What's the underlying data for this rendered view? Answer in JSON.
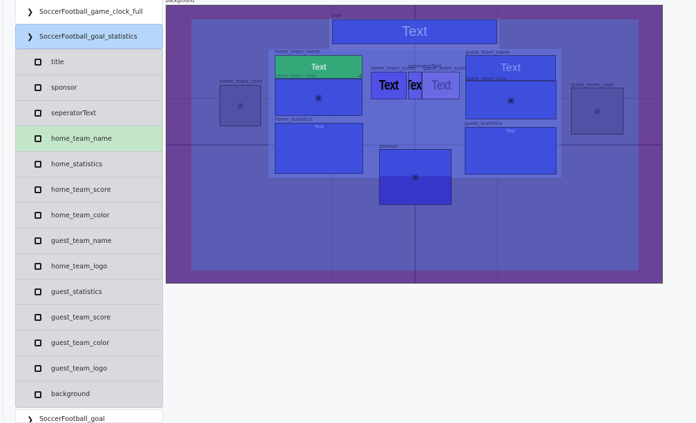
{
  "sidebar": {
    "groups": [
      {
        "label": "SoccerFootball_game_clock_full",
        "icon": "chevron-right-icon",
        "selected": false
      },
      {
        "label": "SoccerFootball_goal_statistics",
        "icon": "chevron-right-icon",
        "selected": true
      },
      {
        "label": "SoccerFootball_goal",
        "icon": "chevron-right-icon",
        "selected": false
      }
    ],
    "children": [
      {
        "label": "title",
        "icon": "square-outline-icon"
      },
      {
        "label": "sponsor",
        "icon": "square-outline-icon"
      },
      {
        "label": "seperatorText",
        "icon": "square-outline-icon"
      },
      {
        "label": "home_team_name",
        "icon": "square-outline-icon",
        "active": true
      },
      {
        "label": "home_statistics",
        "icon": "square-outline-icon"
      },
      {
        "label": "home_team_score",
        "icon": "square-outline-icon"
      },
      {
        "label": "home_team_color",
        "icon": "square-outline-icon"
      },
      {
        "label": "guest_team_name",
        "icon": "square-outline-icon"
      },
      {
        "label": "home_team_logo",
        "icon": "square-outline-icon"
      },
      {
        "label": "guest_statistics",
        "icon": "square-outline-icon"
      },
      {
        "label": "guest_team_score",
        "icon": "square-outline-icon"
      },
      {
        "label": "guest_team_color",
        "icon": "square-outline-icon"
      },
      {
        "label": "guest_team_logo",
        "icon": "square-outline-icon"
      },
      {
        "label": "background",
        "icon": "square-outline-icon"
      }
    ]
  },
  "canvas": {
    "background_label": "background",
    "colors": {
      "background": "#6a4296",
      "safe_area": "#5b5cb3",
      "element": "#3d4fdc",
      "selected_element": "#35a87a"
    },
    "elements": {
      "title": {
        "label": "title",
        "text": "Text"
      },
      "home_team_name": {
        "label": "home_team_name",
        "text": "Text"
      },
      "home_team_logo": {
        "label": "home_team_logo",
        "icon": "image-icon"
      },
      "home_team_color": {
        "label": "home_team_color",
        "icon": "no-entry-icon"
      },
      "home_statistics": {
        "label": "home_statistics",
        "text": "Text"
      },
      "home_team_score": {
        "label": "home_team_score",
        "text": "Text"
      },
      "seperatorText": {
        "label": "seperatorText",
        "text": "Text"
      },
      "guest_team_score": {
        "label": "guest_team_score",
        "text": "Text"
      },
      "guest_team_name": {
        "label": "guest_team_name",
        "text": "Text"
      },
      "guest_team_logo": {
        "label": "guest_team_logo",
        "icon": "image-icon"
      },
      "guest_team_color": {
        "label": "guest_team_color",
        "icon": "no-entry-icon"
      },
      "guest_statistics": {
        "label": "guest_statistics",
        "text": "Text"
      },
      "sponsor": {
        "label": "sponsor",
        "icon": "image-icon"
      }
    }
  }
}
